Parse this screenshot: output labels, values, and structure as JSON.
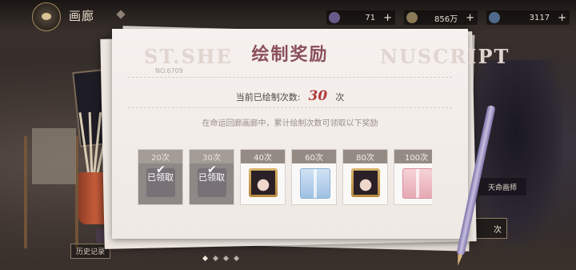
{
  "header": {
    "title": "画廊",
    "resources": [
      {
        "icon": "gem-icon",
        "value": "71"
      },
      {
        "icon": "star-icon",
        "value": "856万"
      },
      {
        "icon": "ticket-icon",
        "value": "3117"
      }
    ]
  },
  "panel": {
    "watermark_left": "ST.SHE",
    "watermark_right": "NUSCRIPT",
    "title": "绘制奖励",
    "serial": "NO.6709",
    "count_label": "当前已绘制次数:",
    "count_value": "30",
    "count_unit": "次",
    "description": "在命运回廊画廊中，累计绘制次数可领取以下奖励"
  },
  "rewards": [
    {
      "label": "20次",
      "status": "已领取",
      "claimed": true,
      "item": "dim"
    },
    {
      "label": "30次",
      "status": "已领取",
      "claimed": true,
      "item": "dim"
    },
    {
      "label": "40次",
      "status": "",
      "claimed": false,
      "item": "portrait"
    },
    {
      "label": "60次",
      "status": "",
      "claimed": false,
      "item": "gift-blue"
    },
    {
      "label": "80次",
      "status": "",
      "claimed": false,
      "item": "portrait"
    },
    {
      "label": "100次",
      "status": "",
      "claimed": false,
      "item": "gift-pink"
    }
  ],
  "right_side": {
    "card_label": "天命画师",
    "button_label": "次"
  },
  "left_side": {
    "button_label": "历史记录"
  },
  "pagination": {
    "count": 4,
    "active": 0
  }
}
